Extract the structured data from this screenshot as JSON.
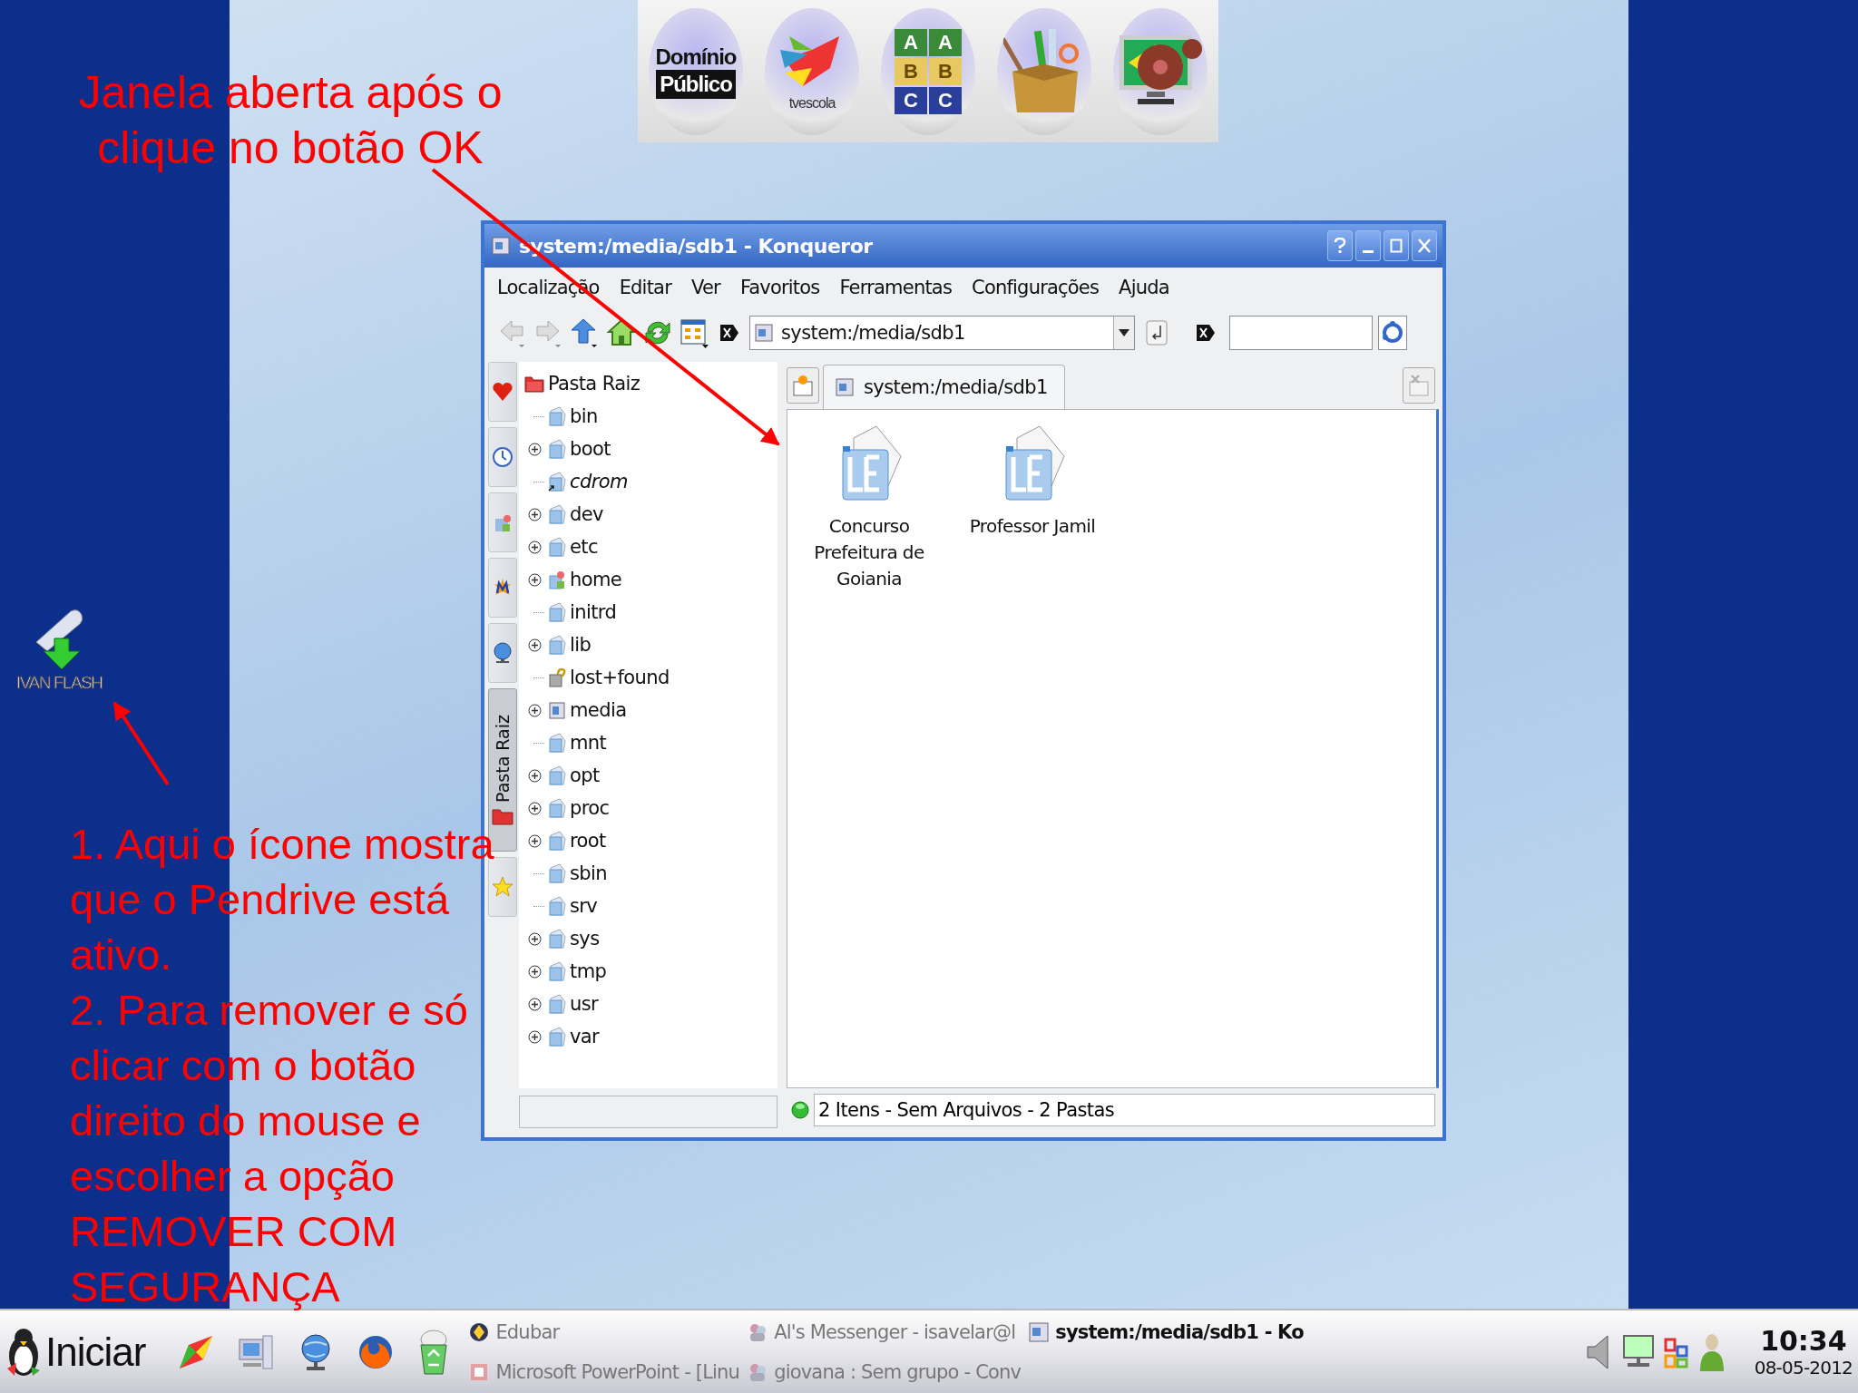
{
  "annotations": {
    "title": "Janela aberta após o\nclique no botão OK",
    "steps": [
      "1. Aqui o ícone mostra\nque o Pendrive está\nativo.",
      "2. Para remover e só\nclicar com o botão\ndireito do mouse e\nescolher a opção\nREMOVER COM\nSEGURANÇA"
    ]
  },
  "banner": {
    "logos": [
      {
        "kind": "dominio",
        "texts": [
          "Domínio",
          "Público"
        ]
      },
      {
        "kind": "tvescola",
        "texts": [
          "tvescola"
        ]
      },
      {
        "kind": "blocks",
        "texts": [
          "A",
          "A",
          "B",
          "B",
          "C",
          "C"
        ]
      },
      {
        "kind": "supplies"
      },
      {
        "kind": "cinema"
      }
    ]
  },
  "desktop_icon": {
    "label": "IVAN FLASH"
  },
  "window": {
    "title": "system:/media/sdb1 - Konqueror",
    "menu": [
      "Localização",
      "Editar",
      "Ver",
      "Favoritos",
      "Ferramentas",
      "Configurações",
      "Ajuda"
    ],
    "location": "system:/media/sdb1",
    "sidebar_tabs": [
      {
        "kind": "bookmarks",
        "selected": false
      },
      {
        "kind": "history",
        "selected": false
      },
      {
        "kind": "home",
        "selected": false
      },
      {
        "kind": "media",
        "selected": false
      },
      {
        "kind": "network",
        "selected": false
      },
      {
        "kind": "root",
        "label": "Pasta Raiz",
        "selected": true
      },
      {
        "kind": "services",
        "selected": false
      }
    ],
    "tree": {
      "label": "Pasta Raiz",
      "children": [
        {
          "name": "bin",
          "kind": "folder",
          "expandable": false,
          "link": false
        },
        {
          "name": "boot",
          "kind": "folder",
          "expandable": true,
          "link": false
        },
        {
          "name": "cdrom",
          "kind": "folder",
          "expandable": false,
          "link": true
        },
        {
          "name": "dev",
          "kind": "folder",
          "expandable": true,
          "link": false
        },
        {
          "name": "etc",
          "kind": "folder",
          "expandable": true,
          "link": false
        },
        {
          "name": "home",
          "kind": "home",
          "expandable": true,
          "link": false
        },
        {
          "name": "initrd",
          "kind": "folder",
          "expandable": false,
          "link": false
        },
        {
          "name": "lib",
          "kind": "folder",
          "expandable": true,
          "link": false
        },
        {
          "name": "lost+found",
          "kind": "lost",
          "expandable": false,
          "link": false
        },
        {
          "name": "media",
          "kind": "device",
          "expandable": true,
          "link": false
        },
        {
          "name": "mnt",
          "kind": "folder",
          "expandable": false,
          "link": false
        },
        {
          "name": "opt",
          "kind": "folder",
          "expandable": true,
          "link": false
        },
        {
          "name": "proc",
          "kind": "folder",
          "expandable": true,
          "link": false
        },
        {
          "name": "root",
          "kind": "folder",
          "expandable": true,
          "link": false
        },
        {
          "name": "sbin",
          "kind": "folder",
          "expandable": false,
          "link": false
        },
        {
          "name": "srv",
          "kind": "folder",
          "expandable": false,
          "link": false
        },
        {
          "name": "sys",
          "kind": "folder",
          "expandable": true,
          "link": false
        },
        {
          "name": "tmp",
          "kind": "folder",
          "expandable": true,
          "link": false
        },
        {
          "name": "usr",
          "kind": "folder",
          "expandable": true,
          "link": false
        },
        {
          "name": "var",
          "kind": "folder",
          "expandable": true,
          "link": false
        }
      ]
    },
    "tab": {
      "label": "system:/media/sdb1",
      "selected": true
    },
    "files": [
      {
        "name": "Concurso\nPrefeitura de\nGoiania"
      },
      {
        "name": "Professor Jamil"
      }
    ],
    "status": "2 Itens - Sem Arquivos - 2 Pastas"
  },
  "taskbar": {
    "start": "Iniciar",
    "tasks": [
      {
        "label": "Edubar",
        "kind": "app",
        "active": false
      },
      {
        "label": "Al's Messenger - isavelar@l",
        "kind": "chat",
        "active": false
      },
      {
        "label": "system:/media/sdb1 - Ko",
        "kind": "browser",
        "active": true
      },
      {
        "label": "Microsoft PowerPoint - [Linu",
        "kind": "presentation",
        "active": false
      },
      {
        "label": "giovana : Sem grupo - Conv",
        "kind": "chat",
        "active": false
      }
    ],
    "clock": "10:34",
    "date": "08-05-2012"
  }
}
